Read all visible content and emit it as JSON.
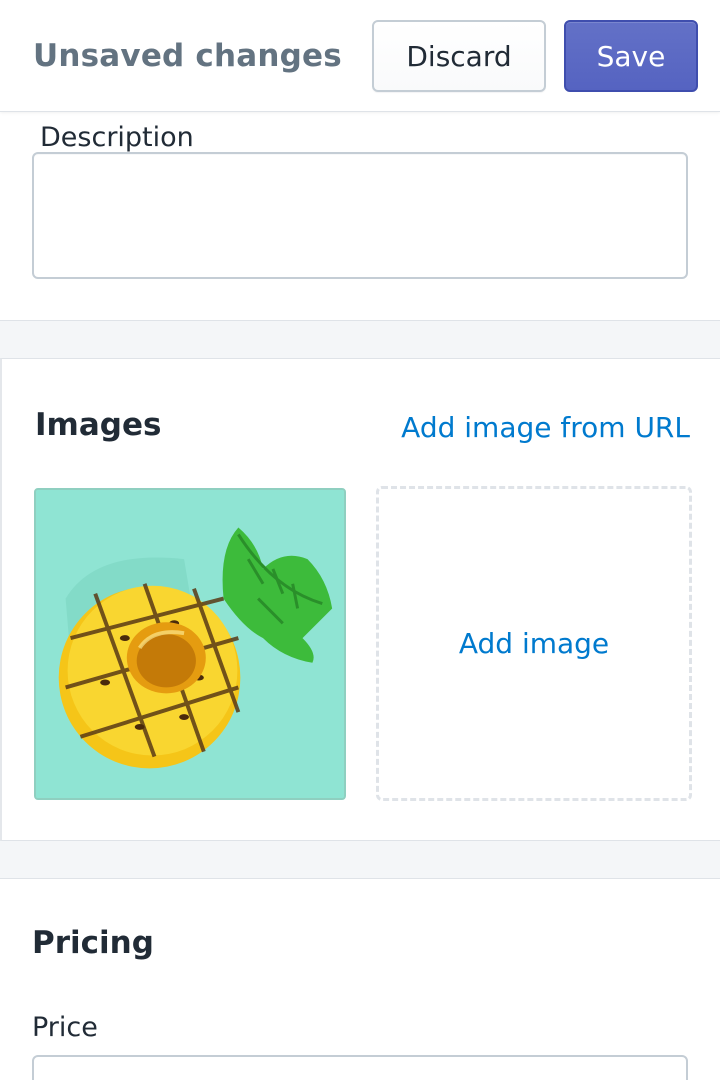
{
  "topbar": {
    "title": "Unsaved changes",
    "discard_label": "Discard",
    "save_label": "Save"
  },
  "description": {
    "label": "Description",
    "value": ""
  },
  "images": {
    "heading": "Images",
    "add_from_url_label": "Add image from URL",
    "add_image_label": "Add image",
    "thumbnail_icon": "pineapple-float-image"
  },
  "pricing": {
    "heading": "Pricing",
    "price_label": "Price",
    "price_value": ""
  },
  "colors": {
    "primary": "#5c6ac4",
    "link": "#007ace",
    "text": "#212b36",
    "subdued": "#637381",
    "background": "#f4f6f8"
  }
}
